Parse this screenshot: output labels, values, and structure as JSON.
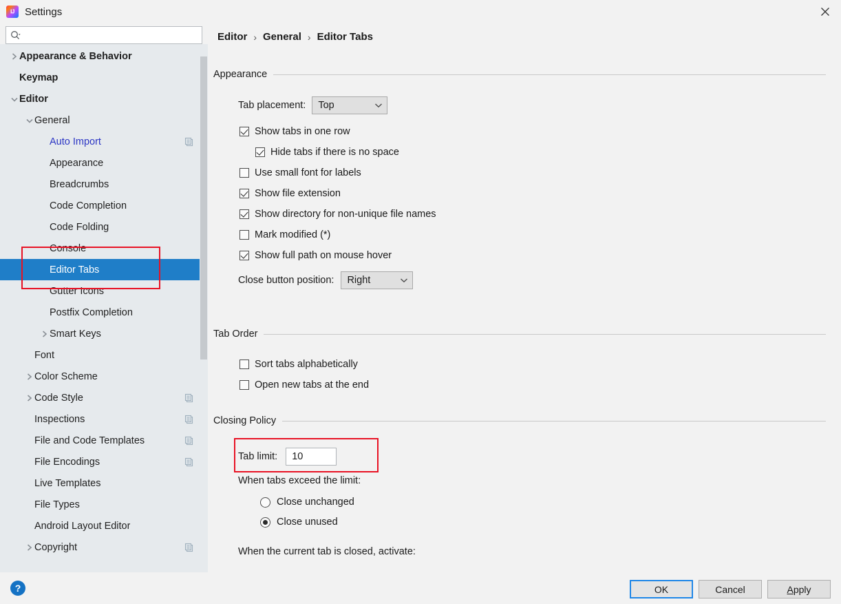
{
  "window": {
    "title": "Settings",
    "app_icon": "intellij-idea-logo",
    "close_icon": "close-icon"
  },
  "search": {
    "placeholder": "",
    "value": "",
    "icon": "search-icon"
  },
  "sidebar": {
    "scrollbar": "vertical-scrollbar",
    "items": [
      {
        "label": "Appearance & Behavior",
        "indent": 0,
        "chevron": "right",
        "bold": true,
        "blue": false,
        "selected": false,
        "copy": false
      },
      {
        "label": "Keymap",
        "indent": 0,
        "chevron": "none",
        "bold": true,
        "blue": false,
        "selected": false,
        "copy": false
      },
      {
        "label": "Editor",
        "indent": 0,
        "chevron": "down",
        "bold": true,
        "blue": false,
        "selected": false,
        "copy": false
      },
      {
        "label": "General",
        "indent": 1,
        "chevron": "down",
        "bold": false,
        "blue": false,
        "selected": false,
        "copy": false
      },
      {
        "label": "Auto Import",
        "indent": 2,
        "chevron": "none",
        "bold": false,
        "blue": true,
        "selected": false,
        "copy": true
      },
      {
        "label": "Appearance",
        "indent": 2,
        "chevron": "none",
        "bold": false,
        "blue": false,
        "selected": false,
        "copy": false
      },
      {
        "label": "Breadcrumbs",
        "indent": 2,
        "chevron": "none",
        "bold": false,
        "blue": false,
        "selected": false,
        "copy": false
      },
      {
        "label": "Code Completion",
        "indent": 2,
        "chevron": "none",
        "bold": false,
        "blue": false,
        "selected": false,
        "copy": false
      },
      {
        "label": "Code Folding",
        "indent": 2,
        "chevron": "none",
        "bold": false,
        "blue": false,
        "selected": false,
        "copy": false
      },
      {
        "label": "Console",
        "indent": 2,
        "chevron": "none",
        "bold": false,
        "blue": false,
        "selected": false,
        "copy": false
      },
      {
        "label": "Editor Tabs",
        "indent": 2,
        "chevron": "none",
        "bold": false,
        "blue": false,
        "selected": true,
        "copy": false
      },
      {
        "label": "Gutter Icons",
        "indent": 2,
        "chevron": "none",
        "bold": false,
        "blue": false,
        "selected": false,
        "copy": false
      },
      {
        "label": "Postfix Completion",
        "indent": 2,
        "chevron": "none",
        "bold": false,
        "blue": false,
        "selected": false,
        "copy": false
      },
      {
        "label": "Smart Keys",
        "indent": 2,
        "chevron": "right",
        "bold": false,
        "blue": false,
        "selected": false,
        "copy": false
      },
      {
        "label": "Font",
        "indent": 1,
        "chevron": "none",
        "bold": false,
        "blue": false,
        "selected": false,
        "copy": false
      },
      {
        "label": "Color Scheme",
        "indent": 1,
        "chevron": "right",
        "bold": false,
        "blue": false,
        "selected": false,
        "copy": false
      },
      {
        "label": "Code Style",
        "indent": 1,
        "chevron": "right",
        "bold": false,
        "blue": false,
        "selected": false,
        "copy": true
      },
      {
        "label": "Inspections",
        "indent": 1,
        "chevron": "none",
        "bold": false,
        "blue": false,
        "selected": false,
        "copy": true
      },
      {
        "label": "File and Code Templates",
        "indent": 1,
        "chevron": "none",
        "bold": false,
        "blue": false,
        "selected": false,
        "copy": true
      },
      {
        "label": "File Encodings",
        "indent": 1,
        "chevron": "none",
        "bold": false,
        "blue": false,
        "selected": false,
        "copy": true
      },
      {
        "label": "Live Templates",
        "indent": 1,
        "chevron": "none",
        "bold": false,
        "blue": false,
        "selected": false,
        "copy": false
      },
      {
        "label": "File Types",
        "indent": 1,
        "chevron": "none",
        "bold": false,
        "blue": false,
        "selected": false,
        "copy": false
      },
      {
        "label": "Android Layout Editor",
        "indent": 1,
        "chevron": "none",
        "bold": false,
        "blue": false,
        "selected": false,
        "copy": false
      },
      {
        "label": "Copyright",
        "indent": 1,
        "chevron": "right",
        "bold": false,
        "blue": false,
        "selected": false,
        "copy": true
      }
    ]
  },
  "breadcrumb": {
    "item1": "Editor",
    "sep1": "›",
    "item2": "General",
    "sep2": "›",
    "item3": "Editor Tabs"
  },
  "appearance": {
    "title": "Appearance",
    "tab_placement_label": "Tab placement:",
    "tab_placement_value": "Top",
    "cb_show_tabs_one_row": "Show tabs in one row",
    "cb_hide_tabs_no_space": "Hide tabs if there is no space",
    "cb_use_small_font": "Use small font for labels",
    "cb_show_file_extension": "Show file extension",
    "cb_show_directory": "Show directory for non-unique file names",
    "cb_mark_modified": "Mark modified (*)",
    "cb_show_full_path": "Show full path on mouse hover",
    "close_button_label": "Close button position:",
    "close_button_value": "Right"
  },
  "tab_order": {
    "title": "Tab Order",
    "cb_sort_alpha": "Sort tabs alphabetically",
    "cb_open_new_end": "Open new tabs at the end"
  },
  "closing_policy": {
    "title": "Closing Policy",
    "tab_limit_label": "Tab limit:",
    "tab_limit_value": "10",
    "when_exceed_label": "When tabs exceed the limit:",
    "rb_close_unchanged": "Close unchanged",
    "rb_close_unused": "Close unused",
    "when_closed_label": "When the current tab is closed, activate:"
  },
  "footer": {
    "help": "?",
    "ok": "OK",
    "cancel": "Cancel",
    "apply_underlined": "A",
    "apply_rest": "pply"
  },
  "colors": {
    "selection_blue": "#1f7ec8",
    "annotation_red": "#e81123",
    "link_blue": "#2b35c4",
    "sidebar_bg": "#e6eaed",
    "panel_bg": "#f2f2f2",
    "help_blue": "#1472c4",
    "focus_blue": "#1f87e8"
  }
}
